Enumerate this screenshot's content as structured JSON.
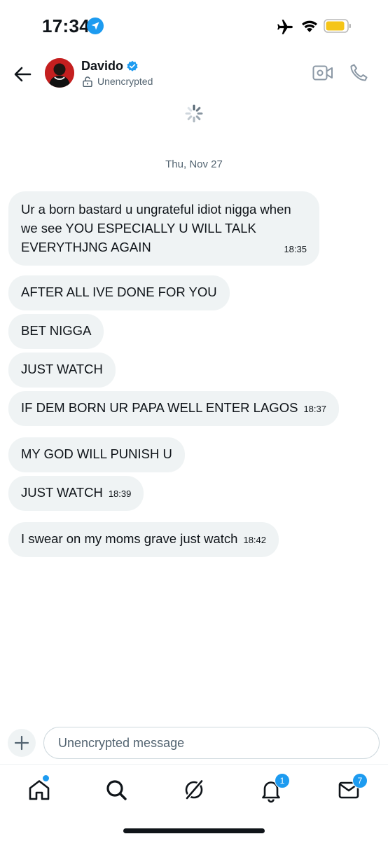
{
  "status_bar": {
    "time": "17:34"
  },
  "header": {
    "contact_name": "Davido",
    "encryption_status": "Unencrypted"
  },
  "conversation": {
    "date_separator": "Thu, Nov 27",
    "messages": [
      {
        "text": "Ur a born bastard u ungrateful idiot nigga when we see YOU ESPECIALLY U WILL TALK EVERYTHJNG AGAIN",
        "time": "18:35"
      },
      {
        "text": "AFTER ALL IVE DONE FOR YOU",
        "time": ""
      },
      {
        "text": "BET NIGGA",
        "time": ""
      },
      {
        "text": "JUST WATCH",
        "time": ""
      },
      {
        "text": "IF DEM BORN UR PAPA WELL ENTER LAGOS",
        "time": "18:37"
      },
      {
        "text": "MY GOD WILL PUNISH U",
        "time": ""
      },
      {
        "text": "JUST WATCH",
        "time": "18:39"
      },
      {
        "text": "I swear on my moms grave just watch",
        "time": "18:42"
      }
    ]
  },
  "composer": {
    "placeholder": "Unencrypted message"
  },
  "tab_bar": {
    "notifications_badge": "1",
    "messages_badge": "7"
  },
  "colors": {
    "accent": "#1d9bf0",
    "bubble_bg": "#eff3f4",
    "text": "#0f1419",
    "secondary_text": "#536471",
    "battery": "#f5c518"
  },
  "icons": [
    "location-arrow-icon",
    "airplane-icon",
    "wifi-icon",
    "battery-icon",
    "back-arrow-icon",
    "verified-badge-icon",
    "lock-open-icon",
    "video-call-icon",
    "phone-icon",
    "loading-spinner-icon",
    "plus-icon",
    "home-icon",
    "search-icon",
    "grok-icon",
    "bell-icon",
    "mail-icon"
  ]
}
